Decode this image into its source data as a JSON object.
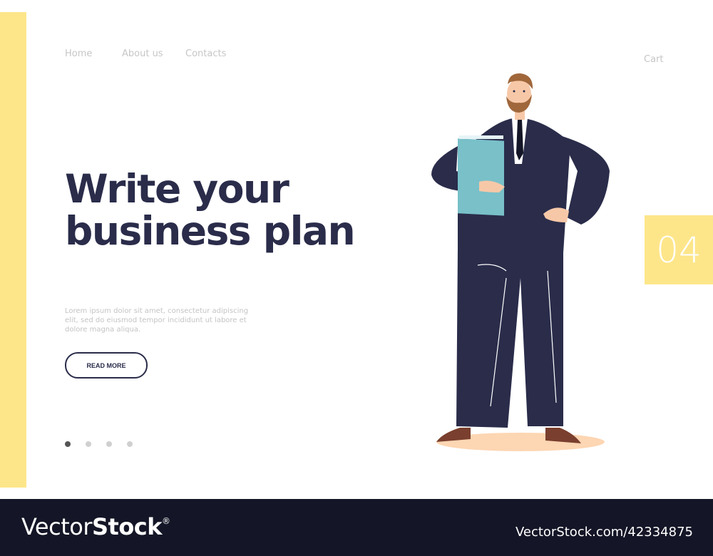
{
  "nav": {
    "items": [
      {
        "label": "Home"
      },
      {
        "label": "About us"
      },
      {
        "label": "Contacts"
      }
    ],
    "cart_label": "Cart"
  },
  "hero": {
    "title_line1": "Write your",
    "title_line2": "business plan",
    "description": "Lorem ipsum dolor sit amet, consectetur adipiscing elit, sed do eiusmod tempor incididunt ut labore et dolore magna aliqua.",
    "read_more_label": "READ MORE",
    "slides": {
      "count": 4,
      "active": 1
    }
  },
  "page_badge": "04",
  "illustration": {
    "subject": "businessman-holding-folder"
  },
  "colors": {
    "accent_yellow": "#fde68a",
    "navy": "#2a2c4a",
    "folder_blue": "#79c0c9",
    "footer_bg": "#141627"
  },
  "footer": {
    "logo_light": "Vector",
    "logo_bold": "Stock",
    "logo_mark": "®",
    "reference": "VectorStock.com/42334875"
  }
}
